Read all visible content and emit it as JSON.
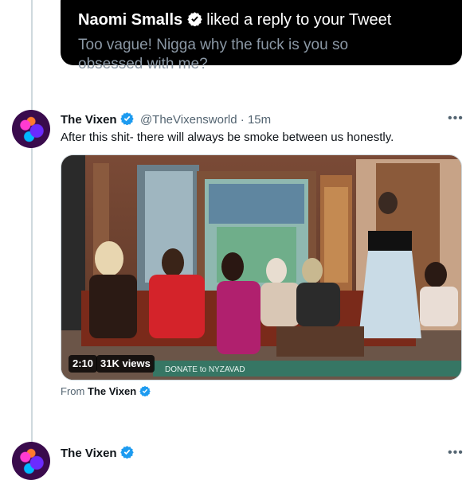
{
  "notification": {
    "name": "Naomi Smalls",
    "action": "liked a reply to your Tweet",
    "text": "Too vague! Nigga why the fuck is you so obsessed with me?"
  },
  "tweet": {
    "name": "The Vixen",
    "handle": "@TheVixensworld",
    "time": "· 15m",
    "text": "After this shit- there will always be smoke between us honestly.",
    "more_icon": "more-horizontal-icon",
    "video": {
      "duration": "2:10",
      "views": "31K views",
      "banner_text": "DONATE to NYZAVAD"
    },
    "from_label": "From",
    "from_name": "The Vixen"
  },
  "next_tweet": {
    "name": "The Vixen",
    "more_icon": "more-horizontal-icon"
  },
  "colors": {
    "verified": "#1d9bf0",
    "secondary_text": "#536471",
    "card_bg": "#000000"
  }
}
